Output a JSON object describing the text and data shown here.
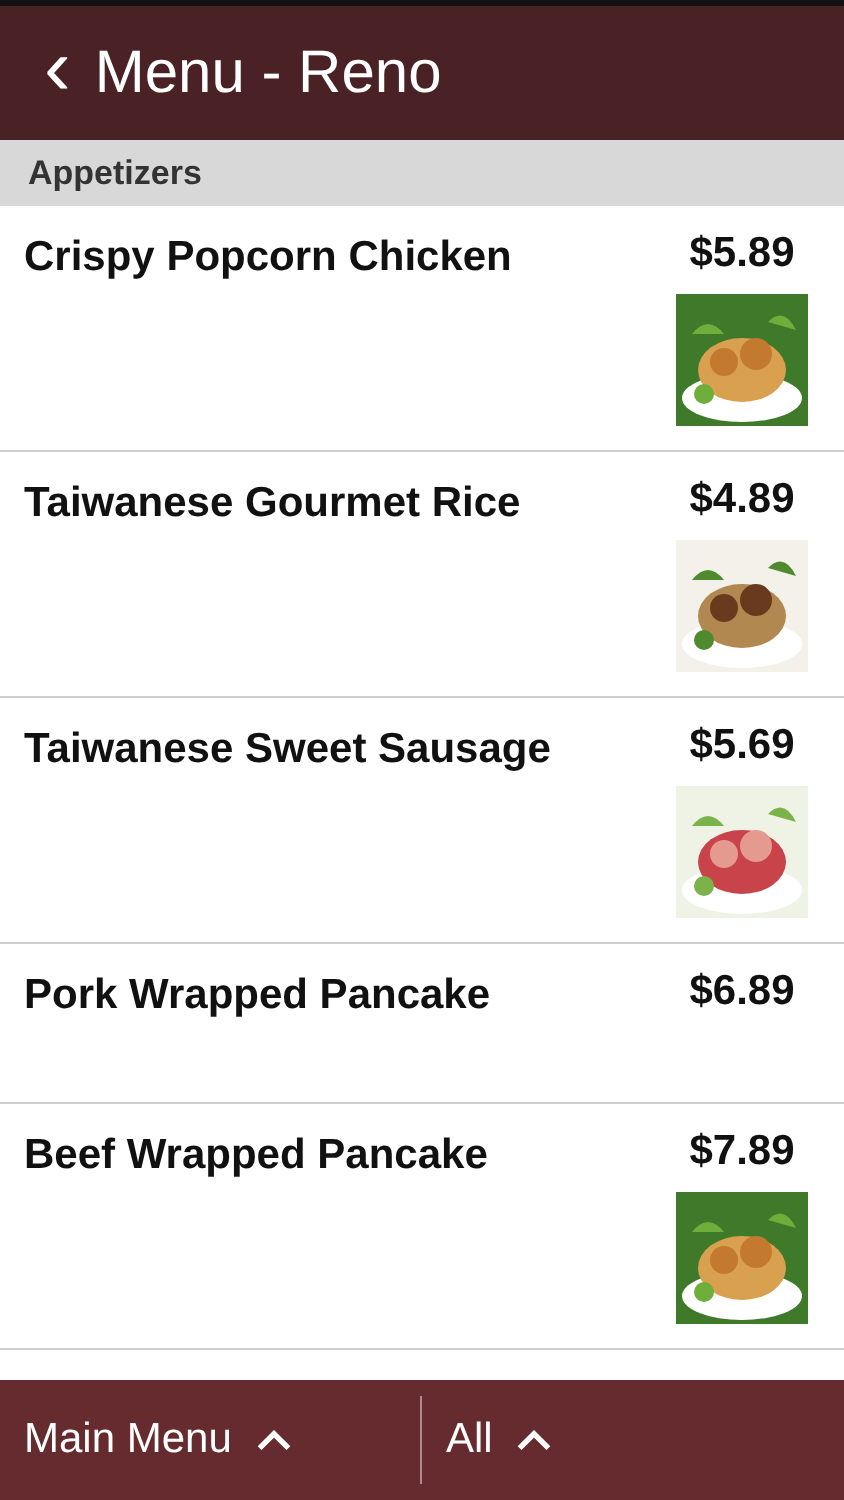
{
  "header": {
    "back_icon": "‹",
    "title": "Menu - Reno"
  },
  "section": {
    "title": "Appetizers"
  },
  "items": [
    {
      "name": "Crispy Popcorn Chicken",
      "price": "$5.89",
      "photo": true
    },
    {
      "name": "Taiwanese Gourmet Rice",
      "price": "$4.89",
      "photo": true
    },
    {
      "name": "Taiwanese Sweet Sausage",
      "price": "$5.69",
      "photo": true
    },
    {
      "name": "Pork Wrapped Pancake",
      "price": "$6.89",
      "photo": false
    },
    {
      "name": "Beef Wrapped Pancake",
      "price": "$7.89",
      "photo": true
    }
  ],
  "bottom_bar": [
    {
      "label": "Main Menu"
    },
    {
      "label": "All"
    }
  ]
}
